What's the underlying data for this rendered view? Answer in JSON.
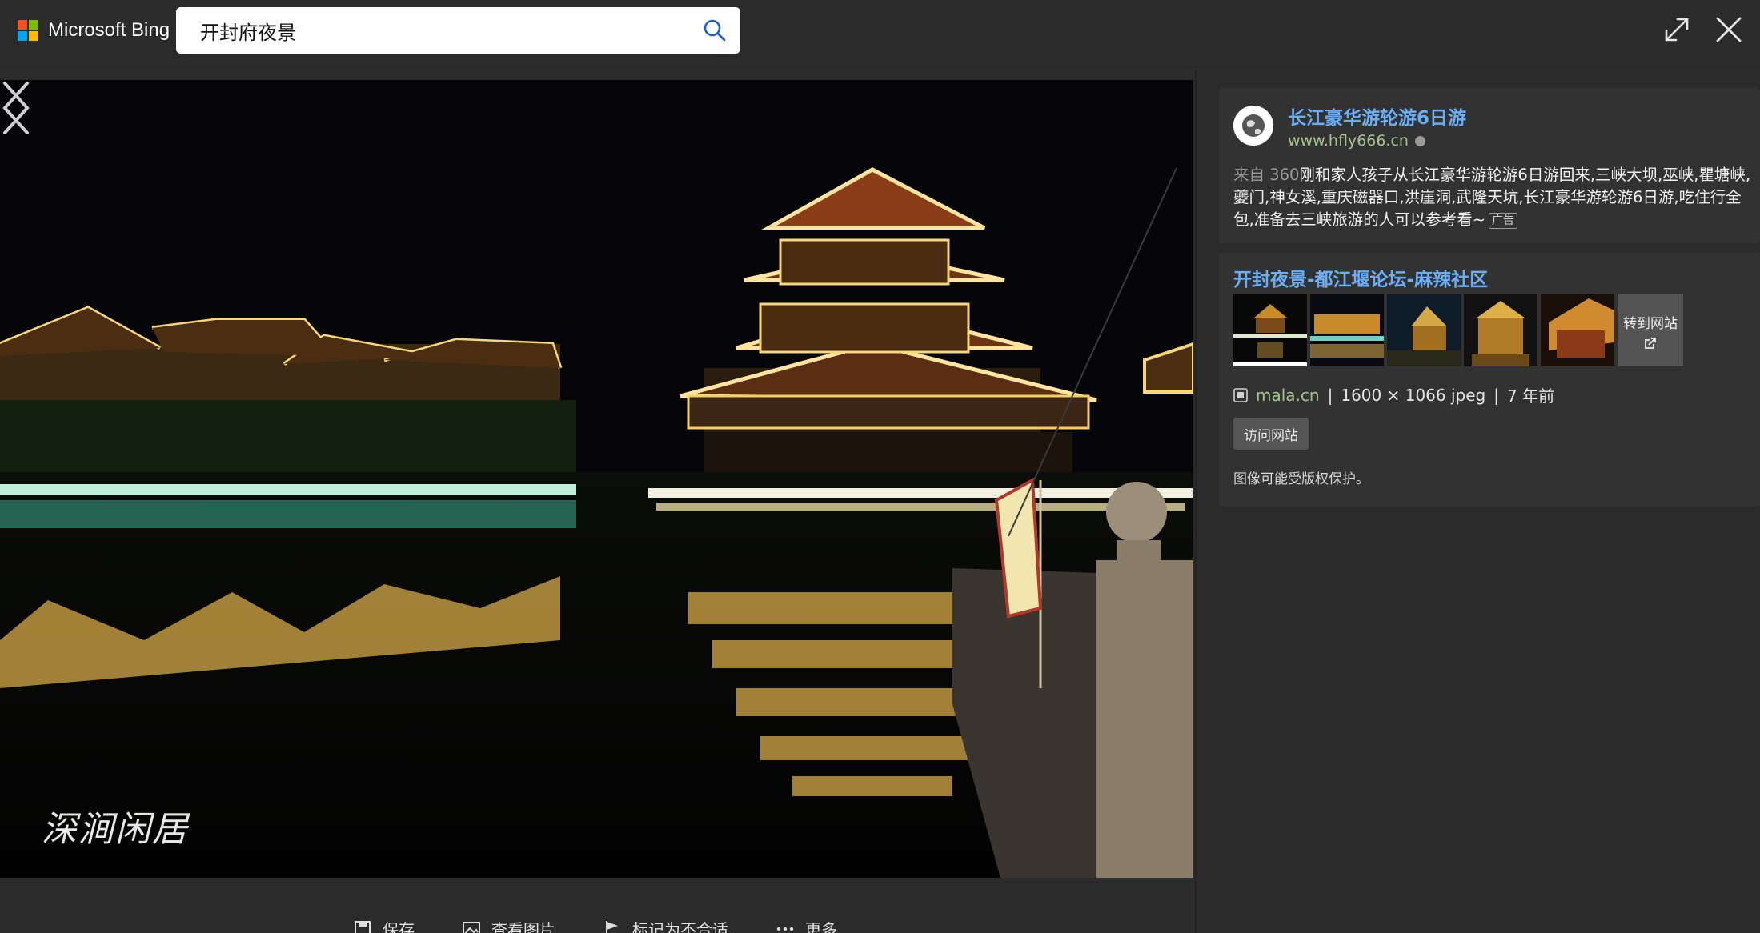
{
  "header": {
    "logo_text": "Microsoft Bing",
    "search_value": "开封府夜景",
    "logo_colors": [
      "#f25022",
      "#7fba00",
      "#00a4ef",
      "#ffb900"
    ]
  },
  "viewer": {
    "watermark": "深涧闲居"
  },
  "ad": {
    "title": "长江豪华游轮游6日游",
    "url": "www.hfly666.cn",
    "from_label": "来自 360",
    "text": "刚和家人孩子从长江豪华游轮游6日游回来,三峡大坝,巫峡,瞿塘峡,夔门,神女溪,重庆磁器口,洪崖洞,武隆天坑,长江豪华游轮游6日游,吃住行全包,准备去三峡旅游的人可以参考看~",
    "badge": "广告"
  },
  "source": {
    "title": "开封夜景-都江堰论坛-麻辣社区",
    "more_label": "转到网站",
    "domain": "mala.cn",
    "dimensions": "1600 × 1066 jpeg",
    "age": "7 年前",
    "separator": "|",
    "visit_label": "访问网站",
    "copyright": "图像可能受版权保护。"
  },
  "actions": [
    {
      "label": "保存"
    },
    {
      "label": "查看图片"
    },
    {
      "label": "标记为不合适"
    },
    {
      "label": "更多"
    }
  ],
  "colors": {
    "link": "#6aaef5",
    "url_green": "#a7c48f",
    "panel_bg": "#323232",
    "page_bg": "#2b2b2b"
  }
}
